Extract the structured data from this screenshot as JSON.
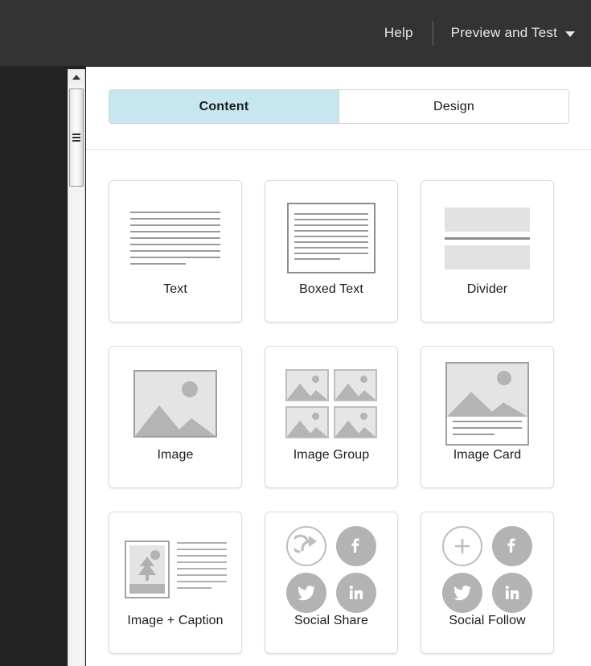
{
  "header": {
    "help_label": "Help",
    "preview_label": "Preview and Test",
    "caret_icon": "chevron-down-icon",
    "background_color": "#333333"
  },
  "scrollbar": {
    "up_arrow_icon": "scroll-up-arrow-icon",
    "thumb_grip_icon": "scrollbar-grip-icon"
  },
  "tabs": {
    "items": [
      {
        "label": "Content",
        "active": true
      },
      {
        "label": "Design",
        "active": false
      }
    ],
    "active_background_color": "#c6e7f0"
  },
  "blocks": {
    "items": [
      {
        "label": "Text",
        "icon": "text-lines-icon"
      },
      {
        "label": "Boxed Text",
        "icon": "boxed-text-icon"
      },
      {
        "label": "Divider",
        "icon": "divider-icon"
      },
      {
        "label": "Image",
        "icon": "image-icon"
      },
      {
        "label": "Image Group",
        "icon": "image-group-icon"
      },
      {
        "label": "Image Card",
        "icon": "image-card-icon"
      },
      {
        "label": "Image + Caption",
        "icon": "image-caption-icon"
      },
      {
        "label": "Social Share",
        "icon": "social-share-icon"
      },
      {
        "label": "Social Follow",
        "icon": "social-follow-icon"
      }
    ],
    "social_share_icons": [
      "share-arrow-icon",
      "facebook-icon",
      "twitter-icon",
      "linkedin-icon"
    ],
    "social_follow_icons": [
      "plus-circle-icon",
      "facebook-icon",
      "twitter-icon",
      "linkedin-icon"
    ],
    "icon_gray": "#b3b3b3",
    "border_color": "#dcdcdc"
  }
}
